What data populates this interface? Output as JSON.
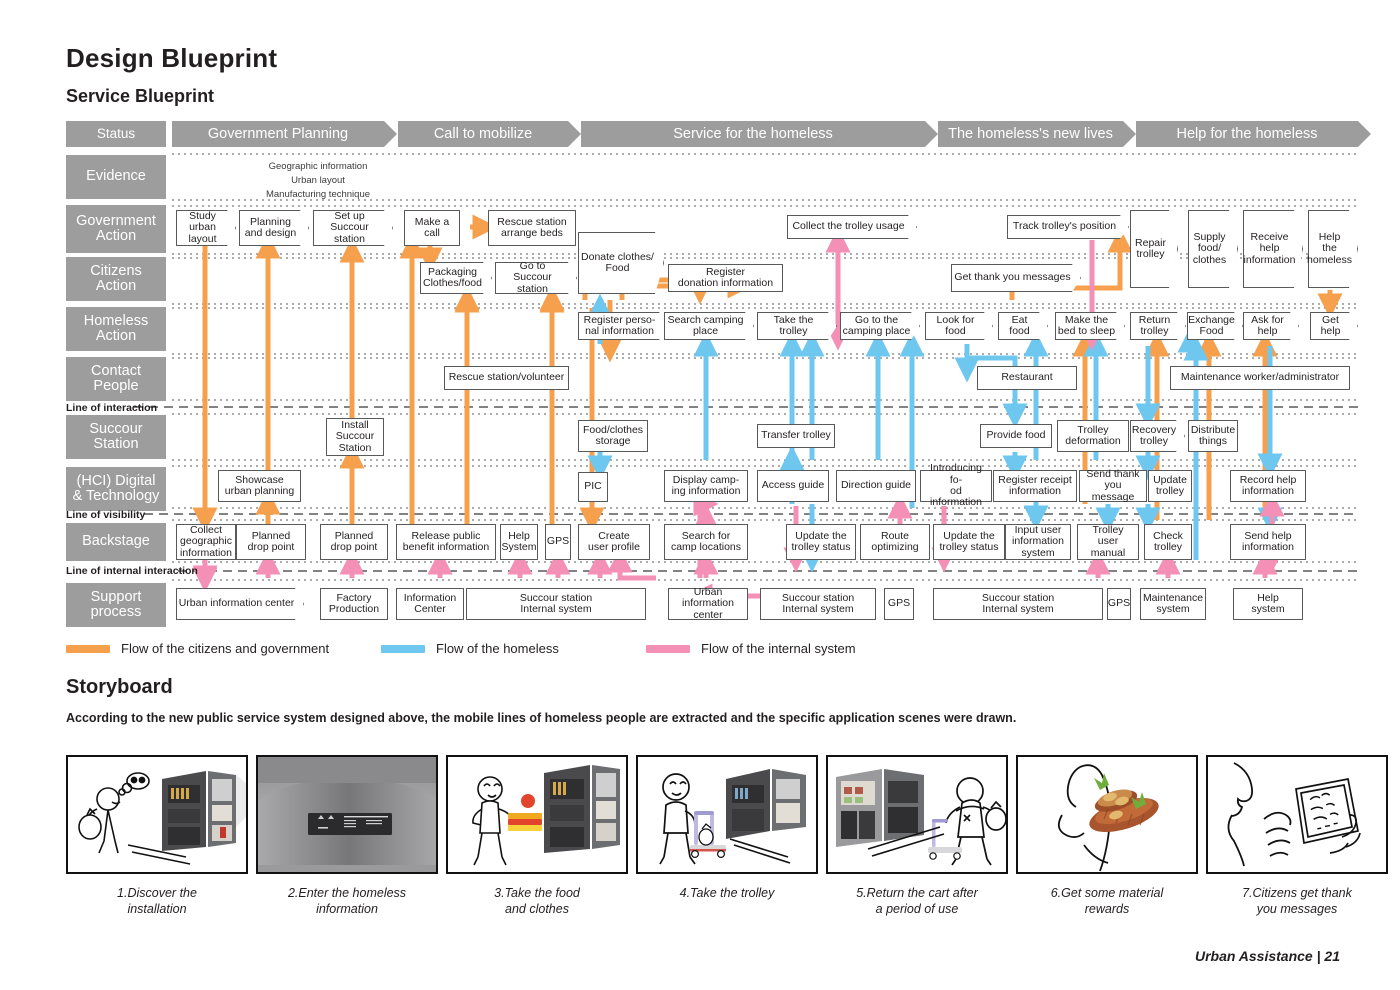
{
  "header": {
    "title": "Design Blueprint",
    "subtitle": "Service Blueprint"
  },
  "footer": "Urban Assistance | 21",
  "blueprint": {
    "status_label": "Status",
    "phases": [
      {
        "label": "Government Planning"
      },
      {
        "label": "Call to mobilize"
      },
      {
        "label": "Service for the homeless"
      },
      {
        "label": "The homeless's new lives"
      },
      {
        "label": "Help for the homeless"
      }
    ],
    "rows": [
      {
        "label": "Evidence"
      },
      {
        "label": "Government\nAction"
      },
      {
        "label": "Citizens\nAction"
      },
      {
        "label": "Homeless\nAction"
      },
      {
        "label": "Contact\nPeople"
      },
      {
        "label": "Succour\nStation"
      },
      {
        "label": "(HCI) Digital\n& Technology"
      },
      {
        "label": "Backstage"
      },
      {
        "label": "Support\nprocess"
      }
    ],
    "divider_labels": [
      "Line of interaction",
      "Line of visibility",
      "Line of internal interaction"
    ],
    "evidence_text": [
      "Geographic information",
      "Urban layout",
      "Manufacturing technique"
    ],
    "government_action": [
      "Study\nurban layout",
      "Planning\nand design",
      "Set up\nSuccour station",
      "Make a\ncall",
      "Rescue station\narrange beds",
      "Donate clothes/\nFood",
      "Collect the trolley usage",
      "Track trolley's position",
      "Repair\ntrolley",
      "Supply\nfood/\nclothes",
      "Receive\nhelp\ninformation",
      "Help\nthe\nhomeless"
    ],
    "citizens_action": [
      "Packaging\nClothes/food",
      "Go to\nSuccour station",
      "Register\ndonation information",
      "Get thank you messages"
    ],
    "homeless_action": [
      "Register perso-\nnal information",
      "Search camping\nplace",
      "Take the trolley",
      "Go to the\ncamping place",
      "Look for food",
      "Eat food",
      "Make the\nbed to sleep",
      "Return\ntrolley",
      "Exchange\nFood",
      "Ask for\nhelp",
      "Get\nhelp"
    ],
    "contact_people": [
      "Rescue station/volunteer",
      "Restaurant",
      "Maintenance worker/administrator"
    ],
    "succour_station": [
      "Install\nSuccour\nStation",
      "Food/clothes\nstorage",
      "Transfer trolley",
      "Provide food",
      "Trolley\ndeformation",
      "Recovery\ntrolley",
      "Distribute\nthings"
    ],
    "digital_technology": [
      "Showcase\nurban planning",
      "PIC",
      "Display camp-\ning information",
      "Access guide",
      "Direction guide",
      "Introducing fo-\nod information",
      "Register receipt\ninformation",
      "Send thank\nyou message",
      "Update\ntrolley",
      "Record help\ninformation"
    ],
    "backstage": [
      "Collect\ngeographic\ninformation",
      "Planned\ndrop point",
      "Planned\ndrop point",
      "Release public\nbenefit information",
      "Help\nSystem",
      "GPS",
      "Create\nuser profile",
      "Search for\ncamp locations",
      "Update the\ntrolley status",
      "Route\noptimizing",
      "Update the\ntrolley status",
      "Input user\ninformation\nsystem",
      "Trolley\nuser manual",
      "Check\ntrolley",
      "Send help\ninformation"
    ],
    "support_process": [
      "Urban information center",
      "Factory\nProduction",
      "Information\nCenter",
      "Succour station\nInternal system",
      "Urban\ninformation\ncenter",
      "Succour station\nInternal system",
      "GPS",
      "Succour station\nInternal system",
      "GPS",
      "Maintenance\nsystem",
      "Help\nsystem"
    ],
    "legend": [
      {
        "label": "Flow of the citizens and government",
        "color": "#f7a košt"
      },
      {
        "label": "Flow of the homeless",
        "color": "#6dc7ee"
      },
      {
        "label": "Flow of the internal system",
        "color": "#f48fb6"
      }
    ],
    "colors": {
      "orange": "#f6a04d",
      "blue": "#6dc7ee",
      "pink": "#f48fb6",
      "header_gray": "#9d9d9d",
      "box_border": "#58595b"
    }
  },
  "storyboard": {
    "title": "Storyboard",
    "description": "According to the new public service system designed above, the mobile lines of homeless people are extracted and the specific application scenes were drawn.",
    "frames": [
      {
        "caption": "1.Discover the\ninstallation"
      },
      {
        "caption": "2.Enter the homeless\ninformation"
      },
      {
        "caption": "3.Take the food\nand clothes"
      },
      {
        "caption": "4.Take the trolley"
      },
      {
        "caption": "5.Return the cart after\na period of use"
      },
      {
        "caption": "6.Get some material\nrewards"
      },
      {
        "caption": "7.Citizens get thank\nyou messages"
      }
    ],
    "kiosk_screen_text": "Please enter your personal information"
  }
}
